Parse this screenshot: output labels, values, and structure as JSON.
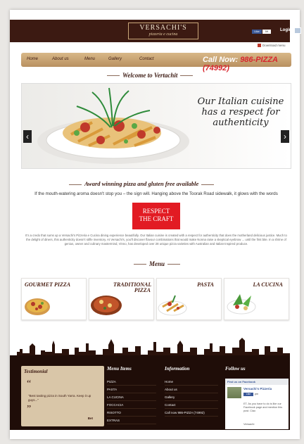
{
  "header": {
    "logo_main": "VERSACHI'S",
    "logo_sub": "pizzeria e cucina",
    "fb_like": "Like",
    "fb_count": "59",
    "login": "Login",
    "download_menu": "Download menu"
  },
  "nav": {
    "items": [
      "Home",
      "About us",
      "Menu",
      "Gallery",
      "Contact"
    ],
    "call_label": "Call Now:",
    "phone": "986-PIZZA (74992)"
  },
  "welcome": {
    "heading": "Welcome to Vertachit",
    "slide_text": "Our Italian cuisine has a respect for authenticity",
    "prev": "‹",
    "next": "›"
  },
  "award": {
    "heading": "Award winning pizza and gluten free available",
    "intro": "If the mouth-watering aroma doesn't stop you – the sign will. Hanging above the Toorak Road sidewalk, it glows with the words",
    "sign_line1": "RESPECT",
    "sign_line2": "THE CRAFT",
    "paragraph": "It's a credo that sums up a Versachi's Pizzeria e Cucina dining experience beautifully. Our Italian cuisine is created with a respect for authenticity that does the motherland delicious justice. Much to the delight of diners, this authenticity doesn't stifle inventory. At Versachi's, you'll discover flavour combinations that would make Nonna raise a skeptical eyebrow ... until the first bite. In a shrine of genius, owner and culinary mastermind, Vinno, has developed over 28 unique pizza varieties with Australian and Italian-inspired produce."
  },
  "menu_section": {
    "heading": "Menu",
    "items": [
      "GOURMET PIZZA",
      "TRADITIONAL PIZZA",
      "PASTA",
      "LA CUCINA"
    ]
  },
  "footer": {
    "testimonial_title": "Testimonial",
    "open_quote": "“",
    "close_quote": "”",
    "testimonial_text": "\"Best tasting pizza in South Yarra. Keep it up guys...\"",
    "testimonial_author": "Bet",
    "menu_items_title": "Menu Items",
    "menu_items": [
      "PIZZA",
      "PASTA",
      "LA CUCINA",
      "FOCCACIA",
      "RISOTTO",
      "EXTRAS"
    ],
    "information_title": "Information",
    "information_items": [
      "Home",
      "About us",
      "Gallery",
      "Contact",
      "Call now 986-PIZZA (74992)"
    ],
    "follow_title": "Follow us",
    "fb_box_title": "Find us on Facebook",
    "fb_page_name": "Versachi's Pizzeria",
    "fb_like": "Like",
    "fb_count": "pm",
    "fb_post": "ET. As you have to do is like our Facebook page and mention this post. Ciao",
    "fb_footer": "Versachi"
  }
}
